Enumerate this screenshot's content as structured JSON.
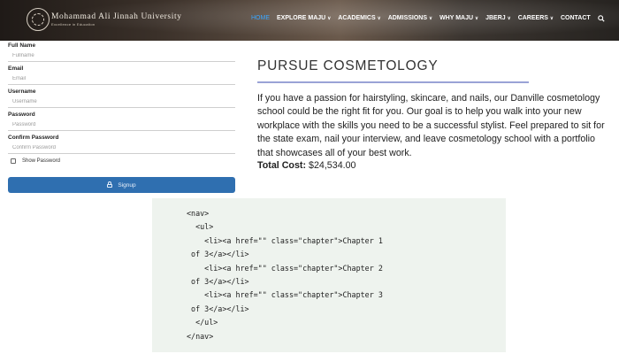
{
  "header": {
    "university_name": "Mohammad Ali Jinnah University",
    "tagline": "Excellence in Education",
    "nav": [
      {
        "label": "HOME",
        "dropdown": false,
        "active": true
      },
      {
        "label": "EXPLORE MAJU",
        "dropdown": true,
        "active": false
      },
      {
        "label": "ACADEMICS",
        "dropdown": true,
        "active": false
      },
      {
        "label": "ADMISSIONS",
        "dropdown": true,
        "active": false
      },
      {
        "label": "WHY MAJU",
        "dropdown": true,
        "active": false
      },
      {
        "label": "JBERJ",
        "dropdown": true,
        "active": false
      },
      {
        "label": "CAREERS",
        "dropdown": true,
        "active": false
      },
      {
        "label": "CONTACT",
        "dropdown": false,
        "active": false
      }
    ],
    "search_icon": "search-icon",
    "active_color": "#3aa6ff"
  },
  "form": {
    "fields": [
      {
        "label": "Full Name",
        "placeholder": "Fullname"
      },
      {
        "label": "Email",
        "placeholder": "Email"
      },
      {
        "label": "Username",
        "placeholder": "Username"
      },
      {
        "label": "Password",
        "placeholder": "Password"
      },
      {
        "label": "Confirm Password",
        "placeholder": "Confirm Password"
      }
    ],
    "show_password_label": "Show Password",
    "signup_label": "Signup",
    "signup_color": "#2f6fb0"
  },
  "article": {
    "title": "PURSUE COSMETOLOGY",
    "body": "If you have a passion for hairstyling, skincare, and nails, our Danville cosmetology school could be the right fit for you. Our goal is to help you walk into your new workplace with the skills you need to be a successful stylist. Feel prepared to sit for the state exam, nail your interview, and leave cosmetology school with a portfolio that showcases all of your best work.",
    "cost_label": "Total Cost:",
    "cost_value": "$24,534.00"
  },
  "code_block": {
    "lines": [
      "<nav>",
      "  <ul>",
      "    <li><a href=\"\" class=\"chapter\">Chapter 1",
      " of 3</a></li>",
      "    <li><a href=\"\" class=\"chapter\">Chapter 2",
      " of 3</a></li>",
      "    <li><a href=\"\" class=\"chapter\">Chapter 3",
      " of 3</a></li>",
      "  </ul>",
      "</nav>"
    ]
  }
}
